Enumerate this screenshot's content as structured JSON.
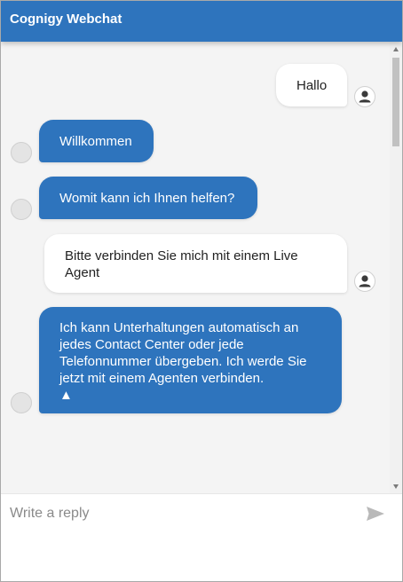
{
  "header": {
    "title": "Cognigy Webchat",
    "background_color": "#2e74bd"
  },
  "messages": [
    {
      "sender": "user",
      "text": "Hallo"
    },
    {
      "sender": "bot",
      "text": "Willkommen"
    },
    {
      "sender": "bot",
      "text": "Womit kann ich Ihnen helfen?"
    },
    {
      "sender": "user",
      "text": "Bitte verbinden Sie mich mit einem Live Agent"
    },
    {
      "sender": "bot",
      "text": "Ich kann Unterhaltungen automatisch an jedes Contact Center oder jede Telefonnummer übergeben. Ich werde Sie jetzt mit einem Agenten verbinden.",
      "trailing_symbol": "▲"
    }
  ],
  "composer": {
    "placeholder": "Write a reply",
    "send_icon": "send-icon"
  },
  "colors": {
    "bot_bubble": "#2e74bd",
    "user_bubble": "#ffffff",
    "chat_background": "#f4f4f4"
  }
}
